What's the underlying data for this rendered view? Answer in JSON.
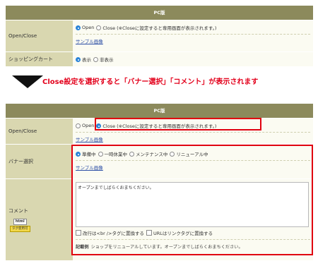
{
  "top_panel": {
    "header": "PC版",
    "rows": [
      {
        "label": "Open/Close",
        "options": [
          {
            "text": "Open",
            "selected": true
          },
          {
            "text": "Close (※Closeに設定すると専用画面が表示されます。)",
            "selected": false
          }
        ],
        "link": "サンプル画像"
      },
      {
        "label": "ショッピングカート",
        "options": [
          {
            "text": "表示",
            "selected": true
          },
          {
            "text": "非表示",
            "selected": false
          }
        ]
      }
    ]
  },
  "caption": "Close設定を選択すると「バナー選択」「コメント」が表示されます",
  "bottom_panel": {
    "header": "PC版",
    "openclose": {
      "label": "Open/Close",
      "options": [
        {
          "text": "Open",
          "selected": false
        },
        {
          "text": "Close (※Closeに設定すると専用画面が表示されます。)",
          "selected": true
        }
      ],
      "link": "サンプル画像"
    },
    "banner": {
      "label": "バナー選択",
      "options": [
        {
          "text": "準備中",
          "selected": true
        },
        {
          "text": "一時休業中",
          "selected": false
        },
        {
          "text": "メンテナンス中",
          "selected": false
        },
        {
          "text": "リニューアル中",
          "selected": false
        }
      ],
      "link": "サンプル画像"
    },
    "comment": {
      "label": "コメント",
      "badge_top": "html",
      "badge_bottom": "タグ使用可",
      "textarea_value": "オープンまでしばらくおまちください。",
      "checkbox_br": "改行は<br />タグに置換する",
      "checkbox_url": "URLはリンクタグに置換する",
      "example_label": "記載例",
      "example_text": "ショップをリニューアルしています。オープンまでしばらくおまちください。"
    }
  },
  "colors": {
    "header_bg": "#8c8a5c",
    "label_bg": "#d9d7b0",
    "value_bg": "#fbfbf2",
    "highlight_red": "#e00010",
    "caption_red": "#e3001b",
    "radio_selected": "#2b84d8"
  }
}
